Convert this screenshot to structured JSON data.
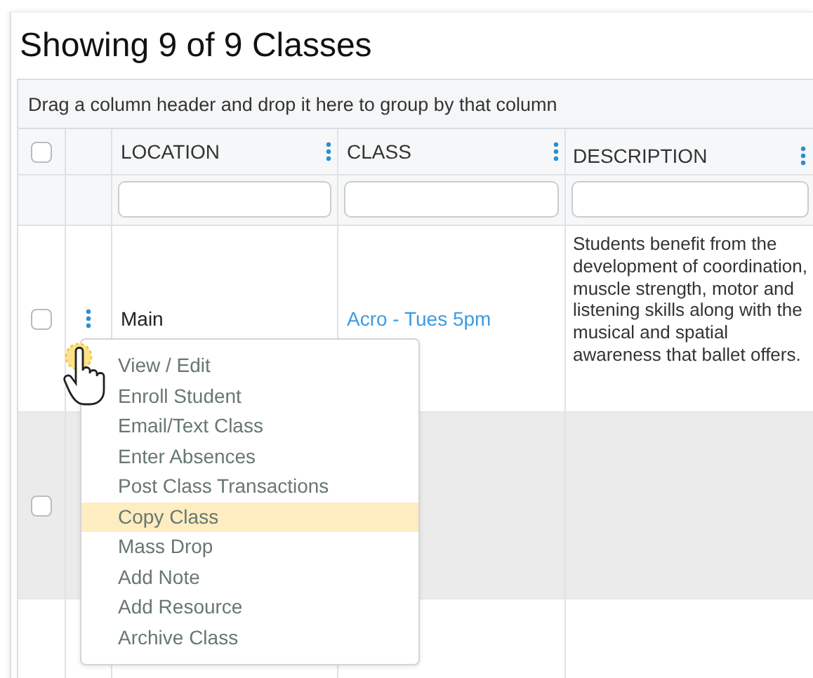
{
  "title": "Showing 9 of 9 Classes",
  "group_hint": "Drag a column header and drop it here to group by that column",
  "header": {
    "checked": false,
    "columns": [
      "LOCATION",
      "CLASS",
      "DESCRIPTION"
    ]
  },
  "rows": [
    {
      "checked": false,
      "location": "Main",
      "class": "Acro - Tues 5pm",
      "description": "Students benefit from the development of coordination, muscle strength, motor and listening skills along with the musical and spatial awareness that ballet offers."
    },
    {
      "checked": false
    }
  ],
  "menu": [
    {
      "label": "View / Edit",
      "selected": false
    },
    {
      "label": "Enroll Student",
      "selected": false
    },
    {
      "label": "Email/Text Class",
      "selected": false
    },
    {
      "label": "Enter Absences",
      "selected": false
    },
    {
      "label": "Post Class Transactions",
      "selected": false
    },
    {
      "label": "Copy Class",
      "selected": true
    },
    {
      "label": "Mass Drop",
      "selected": false
    },
    {
      "label": "Add Note",
      "selected": false
    },
    {
      "label": "Add Resource",
      "selected": false
    },
    {
      "label": "Archive Class",
      "selected": false
    }
  ]
}
